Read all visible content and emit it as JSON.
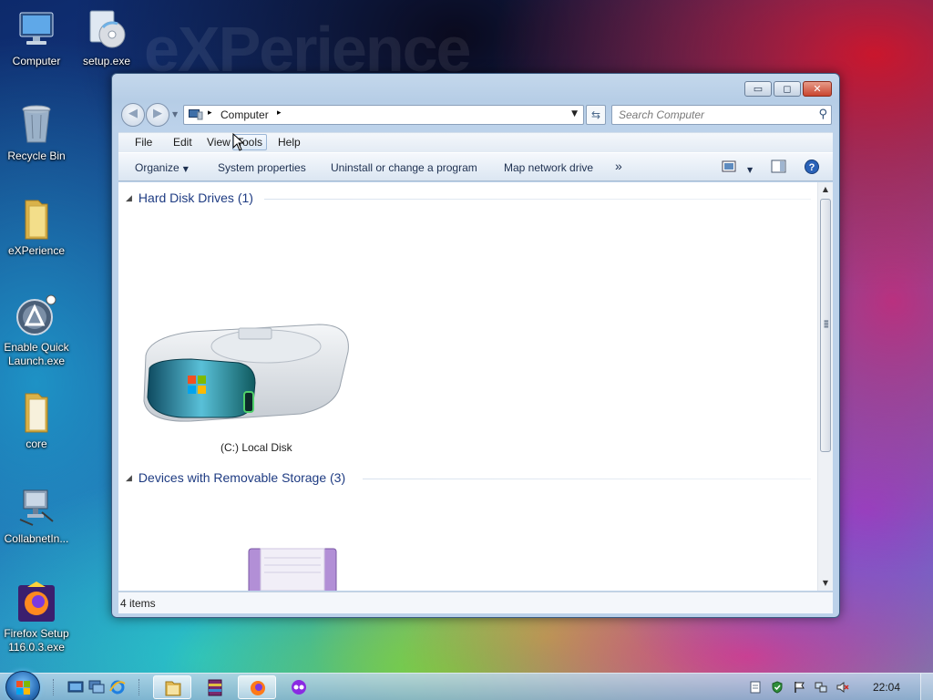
{
  "desktop": {
    "watermark": "eXPerience",
    "icons": [
      {
        "label": "Computer"
      },
      {
        "label": "setup.exe"
      },
      {
        "label": "Recycle Bin"
      },
      {
        "label": "eXPerience"
      },
      {
        "label": "Enable Quick Launch.exe"
      },
      {
        "label": "core"
      },
      {
        "label": "CollabnetIn..."
      },
      {
        "label": "Firefox Setup 116.0.3.exe"
      }
    ]
  },
  "window": {
    "controls": {
      "minimize": "▭",
      "maximize": "◻",
      "close": "✕"
    },
    "address": {
      "crumb": "Computer",
      "separator": "▸"
    },
    "search": {
      "placeholder": "Search Computer"
    },
    "menu": {
      "items": [
        {
          "label": "File"
        },
        {
          "label": "Edit"
        },
        {
          "label": "View"
        },
        {
          "label": "Tools"
        },
        {
          "label": "Help"
        }
      ]
    },
    "commands": {
      "organize": "Organize",
      "system_properties": "System properties",
      "uninstall": "Uninstall or change a program",
      "map_drive": "Map network drive",
      "more": "»"
    },
    "groups": [
      {
        "title": "Hard Disk Drives (1)",
        "items": [
          {
            "label": "(C:) Local Disk"
          }
        ]
      },
      {
        "title": "Devices with Removable Storage (3)",
        "items": []
      }
    ],
    "status": {
      "count": "4 items"
    }
  },
  "taskbar": {
    "clock": "22:04"
  },
  "colors": {
    "group_heading": "#1e3b82",
    "window_frame": "#bcd2ea",
    "close_button": "#c9452e"
  }
}
